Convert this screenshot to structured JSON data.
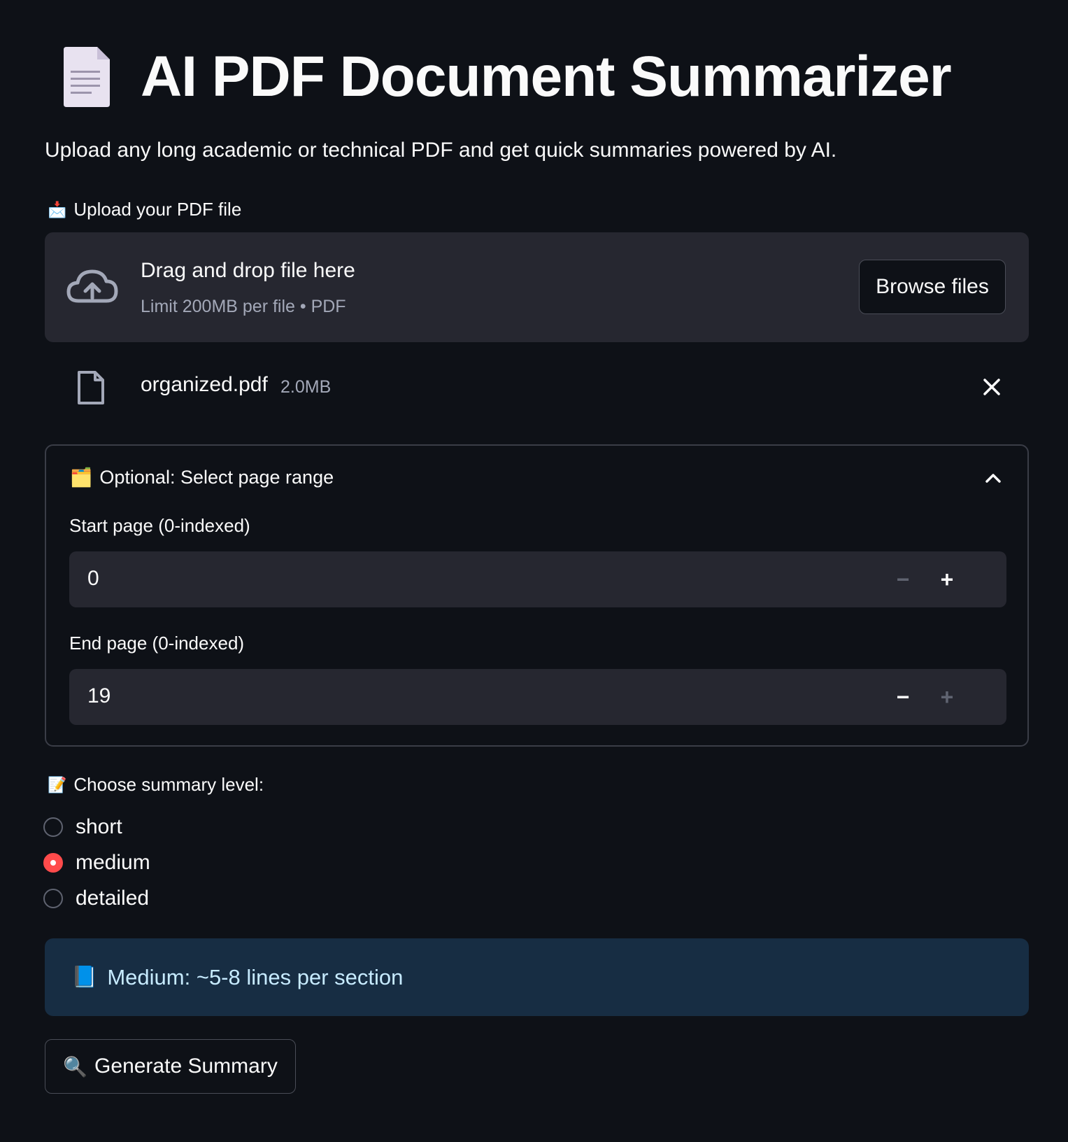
{
  "header": {
    "title": "AI PDF Document Summarizer",
    "title_icon": "page-facing-up-icon",
    "subtitle": "Upload any long academic or technical PDF and get quick summaries powered by AI."
  },
  "uploader": {
    "label": "Upload your PDF file",
    "label_icon": "📩",
    "drop_text": "Drag and drop file here",
    "limit_text": "Limit 200MB per file • PDF",
    "browse_label": "Browse files",
    "file": {
      "name": "organized.pdf",
      "size": "2.0MB"
    }
  },
  "page_range": {
    "header": "Optional: Select page range",
    "header_icon": "🗂️",
    "expanded": true,
    "start": {
      "label": "Start page (0-indexed)",
      "value": "0",
      "minus": "−",
      "plus": "+"
    },
    "end": {
      "label": "End page (0-indexed)",
      "value": "19",
      "minus": "−",
      "plus": "+"
    }
  },
  "summary_level": {
    "label": "Choose summary level:",
    "label_icon": "📝",
    "options": [
      "short",
      "medium",
      "detailed"
    ],
    "selected": "medium"
  },
  "info": {
    "icon": "📘",
    "text": "Medium: ~5-8 lines per section"
  },
  "actions": {
    "generate_icon": "🔍",
    "generate_label": "Generate Summary"
  },
  "colors": {
    "background": "#0e1117",
    "surface": "#262730",
    "accent": "#ff4b4b",
    "info_bg": "#172d43",
    "info_text": "#c7ebff"
  }
}
